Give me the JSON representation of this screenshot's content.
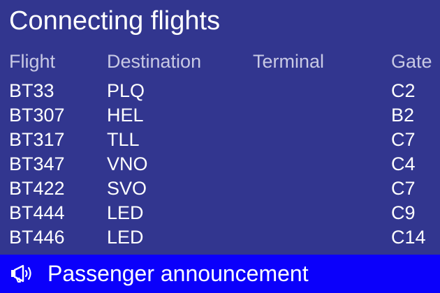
{
  "title": "Connecting flights",
  "columns": {
    "flight": "Flight",
    "destination": "Destination",
    "terminal": "Terminal",
    "gate": "Gate"
  },
  "rows": [
    {
      "flight": "BT33",
      "destination": "PLQ",
      "terminal": "",
      "gate": "C2"
    },
    {
      "flight": "BT307",
      "destination": "HEL",
      "terminal": "",
      "gate": "B2"
    },
    {
      "flight": "BT317",
      "destination": "TLL",
      "terminal": "",
      "gate": "C7"
    },
    {
      "flight": "BT347",
      "destination": "VNO",
      "terminal": "",
      "gate": "C4"
    },
    {
      "flight": "BT422",
      "destination": "SVO",
      "terminal": "",
      "gate": "C7"
    },
    {
      "flight": "BT444",
      "destination": "LED",
      "terminal": "",
      "gate": "C9"
    },
    {
      "flight": "BT446",
      "destination": "LED",
      "terminal": "",
      "gate": "C14"
    }
  ],
  "announcement": {
    "icon": "megaphone-icon",
    "text": "Passenger announcement"
  },
  "colors": {
    "background": "#32368f",
    "announcement_bar": "#0b00fb",
    "header_text": "#c8c9e4",
    "text": "#ffffff"
  }
}
